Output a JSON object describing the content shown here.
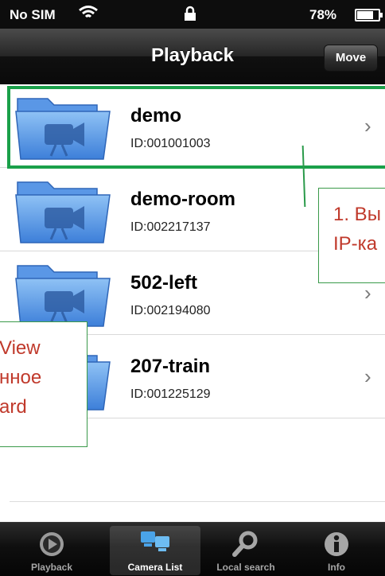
{
  "status_bar": {
    "carrier": "No SIM",
    "battery_percent": "78%",
    "battery_level": 0.78
  },
  "nav": {
    "title": "Playback",
    "move_label": "Move"
  },
  "cameras": [
    {
      "name": "demo",
      "id": "ID:001001003"
    },
    {
      "name": "demo-room",
      "id": "ID:002217137"
    },
    {
      "name": "502-left",
      "id": "ID:002194080"
    },
    {
      "name": "207-train",
      "id": "ID:001225129"
    }
  ],
  "callouts": {
    "right": {
      "line1": "1. Вы",
      "line2": "IP-ка"
    },
    "left": {
      "line1": "View",
      "line2": "нное",
      "line3": "ard"
    }
  },
  "tabs": [
    {
      "label": "Playback",
      "icon": "playback-icon"
    },
    {
      "label": "Camera List",
      "icon": "camera-list-icon"
    },
    {
      "label": "Local search",
      "icon": "search-icon"
    },
    {
      "label": "Info",
      "icon": "info-icon"
    }
  ],
  "colors": {
    "highlight": "#1aa04a",
    "callout_text": "#c0392b",
    "folder_blue": "#4f8fe0"
  }
}
